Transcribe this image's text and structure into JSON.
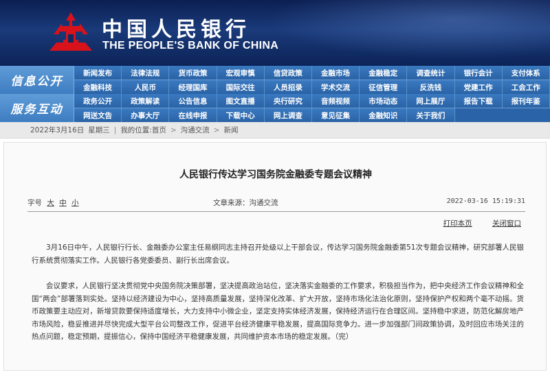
{
  "header": {
    "cn_name": "中国人民银行",
    "en_name": "THE PEOPLE'S BANK OF CHINA",
    "logo_icon": "pboc-emblem-icon",
    "brand_red": "#d8121b",
    "bg_color": "#0f2a60"
  },
  "nav": {
    "group1": {
      "label": "信息公开",
      "row1": [
        "新闻发布",
        "法律法规",
        "货币政策",
        "宏观审慎",
        "信贷政策",
        "金融市场",
        "金融稳定",
        "调查统计",
        "银行会计",
        "支付体系"
      ],
      "row2": [
        "金融科技",
        "人民币",
        "经理国库",
        "国际交往",
        "人员招录",
        "学术交流",
        "征信管理",
        "反洗钱",
        "党建工作",
        "工会工作"
      ]
    },
    "group2": {
      "label": "服务互动",
      "row1": [
        "政务公开",
        "政策解读",
        "公告信息",
        "图文直播",
        "央行研究",
        "音频视频",
        "市场动态",
        "网上展厅",
        "报告下载",
        "报刊年鉴"
      ],
      "row2": [
        "网送文告",
        "办事大厅",
        "在线申报",
        "下载中心",
        "网上调查",
        "意见征集",
        "金融知识",
        "关于我们"
      ]
    }
  },
  "breadcrumb": {
    "date": "2022年3月16日",
    "weekday": "星期三",
    "location_label": "我的位置:",
    "items": [
      "首页",
      "沟通交流",
      "新闻"
    ],
    "sep": "|",
    "arrow": ">"
  },
  "article": {
    "title": "人民银行传达学习国务院金融委专题会议精神",
    "font_size_label": "字号",
    "font_sizes": [
      "大",
      "中",
      "小"
    ],
    "source": "文章来源：沟通交流",
    "datetime": "2022-03-16 15:19:31",
    "print_label": "打印本页",
    "close_label": "关闭窗口",
    "paragraphs": [
      "3月16日中午，人民银行行长、金融委办公室主任易纲同志主持召开处级以上干部会议，传达学习国务院金融委第51次专题会议精神，研究部署人民银行系统贯彻落实工作。人民银行各党委委员、副行长出席会议。",
      "会议要求，人民银行坚决贯彻党中央国务院决策部署，坚决提高政治站位，坚决落实金融委的工作要求，积极担当作为，把中央经济工作会议精神和全国“两会”部署落到实处。坚持以经济建设为中心，坚持高质量发展，坚持深化改革、扩大开放，坚持市场化法治化原则，坚持保护产权和两个毫不动摇。货币政策要主动应对，新增贷款要保持适度增长，大力支持中小微企业，坚定支持实体经济发展，保持经济运行在合理区间。坚持稳中求进，防范化解房地产市场风险，稳妥推进并尽快完成大型平台公司整改工作，促进平台经济健康平稳发展，提高国际竞争力。进一步加强部门间政策协调，及时回应市场关注的热点问题，稳定预期，提振信心，保持中国经济平稳健康发展，共同维护资本市场的稳定发展。（完）"
    ]
  }
}
